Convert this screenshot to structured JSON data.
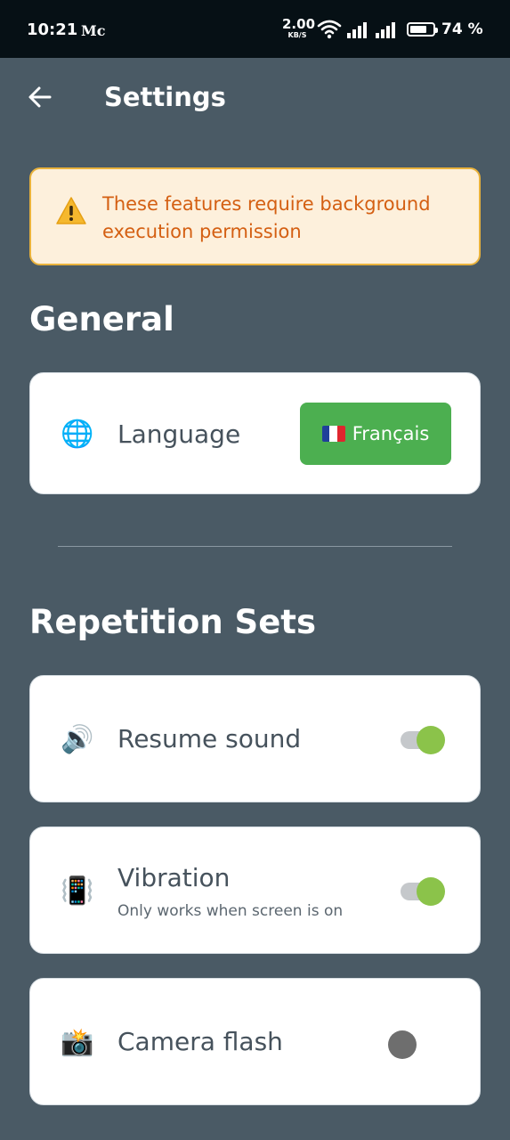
{
  "status_bar": {
    "time": "10:21",
    "carrier": "Mc",
    "speed_value": "2.00",
    "speed_unit": "KB/S",
    "battery_percent": "74 %",
    "battery_level": 0.74
  },
  "header": {
    "title": "Settings",
    "back_icon": "arrow-left-icon"
  },
  "warning": {
    "icon": "warning-icon",
    "text": "These features require background execution permission"
  },
  "sections": {
    "general": {
      "title": "General",
      "language": {
        "icon": "🌐",
        "label": "Language",
        "button_flag": "france-flag-icon",
        "button_label": "Français"
      }
    },
    "repetition_sets": {
      "title": "Repetition Sets",
      "resume_sound": {
        "icon": "🔊",
        "label": "Resume sound",
        "enabled": true
      },
      "vibration": {
        "icon": "📳",
        "label": "Vibration",
        "sublabel": "Only works when screen is on",
        "enabled": true
      },
      "camera_flash": {
        "icon": "📸",
        "label": "Camera flash",
        "enabled": false
      }
    }
  },
  "colors": {
    "background": "#4a5a65",
    "status_bar": "#061015",
    "warning_bg": "#fdf0dc",
    "warning_border": "#e9b23c",
    "warning_text": "#d45f12",
    "accent_green": "#4caf50",
    "toggle_on": "#8bc34a",
    "toggle_off": "#6e6e6e"
  }
}
